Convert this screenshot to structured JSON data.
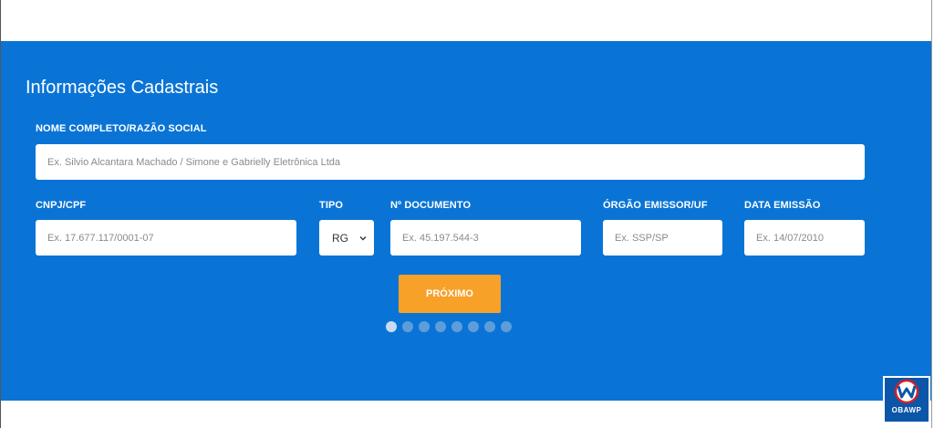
{
  "form": {
    "title": "Informações Cadastrais",
    "name": {
      "label": "NOME COMPLETO/RAZÃO SOCIAL",
      "placeholder": "Ex. Silvio Alcantara Machado / Simone e Gabrielly Eletrônica Ltda"
    },
    "cnpj": {
      "label": "CNPJ/CPF",
      "placeholder": "Ex. 17.677.117/0001-07"
    },
    "tipo": {
      "label": "TIPO",
      "selected": "RG"
    },
    "documento": {
      "label": "Nº DOCUMENTO",
      "placeholder": "Ex. 45.197.544-3"
    },
    "orgao": {
      "label": "ÓRGÃO EMISSOR/UF",
      "placeholder": "Ex. SSP/SP"
    },
    "data_emissao": {
      "label": "DATA EMISSÃO",
      "placeholder": "Ex. 14/07/2010"
    },
    "next_button": "PRÓXIMO"
  },
  "pagination": {
    "total_steps": 8,
    "current_step": 1
  },
  "logo": {
    "text": "OBAWP",
    "icon": "w-circle-logo-icon"
  },
  "colors": {
    "panel": "#0a74d6",
    "button": "#f7a128",
    "dot": "#5d9ed8",
    "dot_active": "#c9dcef"
  }
}
